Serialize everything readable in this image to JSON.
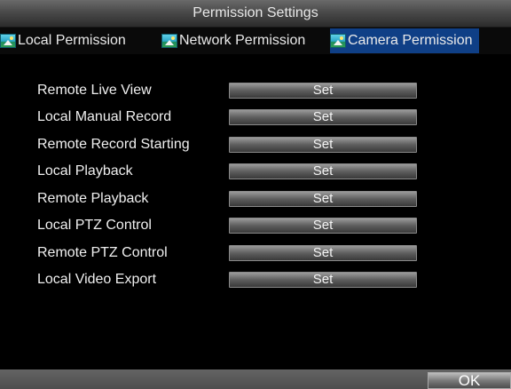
{
  "window": {
    "title": "Permission Settings"
  },
  "tabs": [
    {
      "label": "Local Permission",
      "icon": "landscape-icon",
      "active": false
    },
    {
      "label": "Network Permission",
      "icon": "landscape-icon",
      "active": false
    },
    {
      "label": "Camera Permission",
      "icon": "landscape-icon",
      "active": true
    }
  ],
  "permissions": [
    {
      "label": "Remote Live View",
      "button": "Set"
    },
    {
      "label": "Local Manual Record",
      "button": "Set"
    },
    {
      "label": "Remote Record Starting",
      "button": "Set"
    },
    {
      "label": "Local Playback",
      "button": "Set"
    },
    {
      "label": "Remote Playback",
      "button": "Set"
    },
    {
      "label": "Local PTZ Control",
      "button": "Set"
    },
    {
      "label": "Remote PTZ Control",
      "button": "Set"
    },
    {
      "label": "Local Video Export",
      "button": "Set"
    }
  ],
  "footer": {
    "ok_label": "OK"
  },
  "colors": {
    "active_tab": "#0f3f86",
    "background": "#000000",
    "button_gradient_top": "#9a9a9a",
    "button_gradient_bottom": "#3a3a3a"
  }
}
